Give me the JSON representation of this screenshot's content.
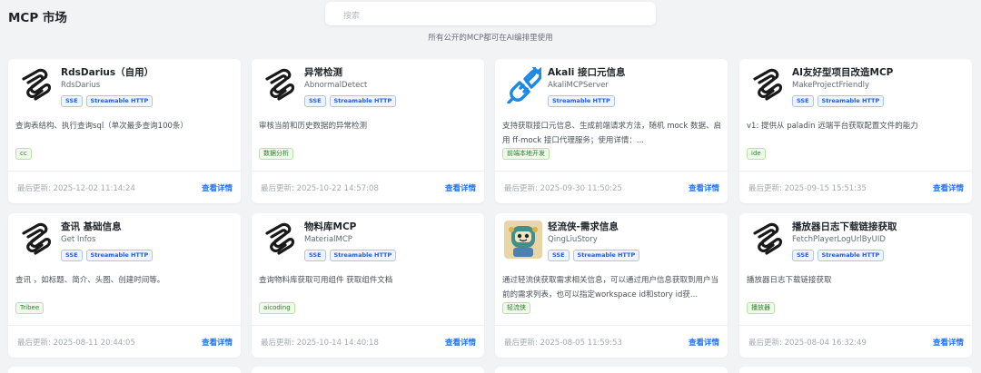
{
  "header": {
    "title": "MCP 市场",
    "search_placeholder": "搜索",
    "subtitle": "所有公开的MCP都可在AI编排里使用"
  },
  "common": {
    "updated_prefix": "最后更新:",
    "view_details": "查看详情"
  },
  "colors": {
    "accent": "#1f6feb",
    "tag_blue": "#245bdb",
    "label_green": "#2e7d32",
    "background": "#f2f3f5"
  },
  "cards": [
    {
      "icon": "spiral-logo-icon",
      "title": "RdsDarius（自用）",
      "id": "RdsDarius",
      "tags": [
        "SSE",
        "Streamable HTTP"
      ],
      "description": "查询表结构、执行查询sql（单次最多查询100条）",
      "label": "cc",
      "updated": "2025-12-02 11:14:24"
    },
    {
      "icon": "spiral-logo-icon",
      "title": "异常检测",
      "id": "AbnormalDetect",
      "tags": [
        "SSE",
        "Streamable HTTP"
      ],
      "description": "审核当前和历史数据的异常检测",
      "label": "数据分析",
      "updated": "2025-10-22 14:57:08"
    },
    {
      "icon": "plug-connector-icon",
      "title": "Akali 接口元信息",
      "id": "AkaliMCPServer",
      "tags": [
        "Streamable HTTP"
      ],
      "description": "支持获取接口元信息、生成前端请求方法，随机 mock 数据、启用 ff-mock 接口代理服务；使用详情：...",
      "label": "前端本地开发",
      "updated": "2025-09-30 11:50:25"
    },
    {
      "icon": "spiral-logo-icon",
      "title": "AI友好型项目改造MCP",
      "id": "MakeProjectFriendly",
      "tags": [
        "SSE",
        "Streamable HTTP"
      ],
      "description": "v1: 提供从 paladin 远端平台获取配置文件的能力",
      "label": "ide",
      "updated": "2025-09-15 15:51:35"
    },
    {
      "icon": "spiral-logo-icon",
      "title": "查讯    基础信息",
      "id": "Get      Infos",
      "tags": [
        "SSE",
        "Streamable HTTP"
      ],
      "description": "查讯              ，如标题、简介、头图、创建时间等。",
      "label": "Tribee",
      "updated": "2025-08-11 20:44:05"
    },
    {
      "icon": "spiral-logo-icon",
      "title": "物料库MCP",
      "id": "MaterialMCP",
      "tags": [
        "SSE",
        "Streamable HTTP"
      ],
      "description": "查询物料库获取可用组件 获取组件文档",
      "label": "aicoding",
      "updated": "2025-10-14 14:40:18"
    },
    {
      "icon": "robot-avatar-icon",
      "title": "轻流侠-需求信息",
      "id": "QingLiuStory",
      "tags": [
        "SSE",
        "Streamable HTTP"
      ],
      "description": "通过轻流侠获取需求相关信息，可以通过用户信息获取到用户当前的需求列表，也可以指定workspace id和story id获...",
      "label": "轻流侠",
      "updated": "2025-08-05 11:59:53"
    },
    {
      "icon": "spiral-logo-icon",
      "title": "播放器日志下载链接获取",
      "id": "FetchPlayerLogUrlByUID",
      "tags": [
        "SSE",
        "Streamable HTTP"
      ],
      "description": "播放器日志下载链接获取",
      "label": "播放器",
      "updated": "2025-08-04 16:32:49"
    }
  ]
}
